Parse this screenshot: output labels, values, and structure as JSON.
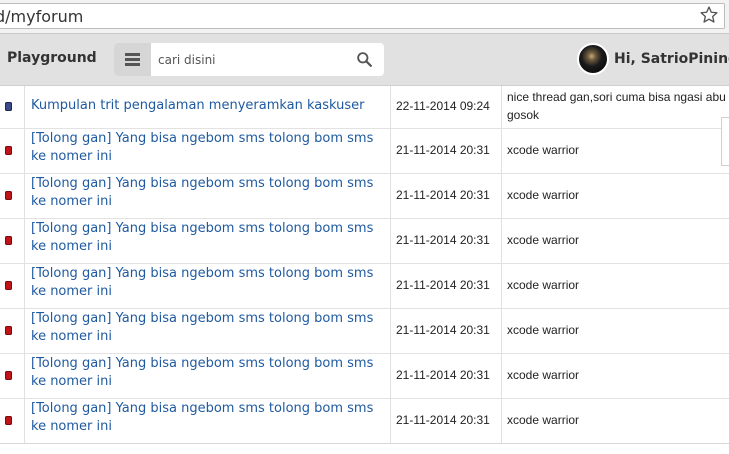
{
  "browser": {
    "url": "d/myforum"
  },
  "header": {
    "brand": "Playground",
    "search_placeholder": "cari disini",
    "greeting": "Hi, SatrioPininggi"
  },
  "threads": [
    {
      "title": "Kumpulan trit pengalaman menyeramkan kaskuser",
      "date": "22-11-2014 09:24",
      "last": "nice thread gan,sori cuma bisa ngasi abu gosok",
      "status": "blue"
    },
    {
      "title": "[Tolong gan] Yang bisa ngebom sms tolong bom sms ke nomer ini",
      "date": "21-11-2014 20:31",
      "last": "xcode warrior",
      "status": "red"
    },
    {
      "title": "[Tolong gan] Yang bisa ngebom sms tolong bom sms ke nomer ini",
      "date": "21-11-2014 20:31",
      "last": "xcode warrior",
      "status": "red"
    },
    {
      "title": "[Tolong gan] Yang bisa ngebom sms tolong bom sms ke nomer ini",
      "date": "21-11-2014 20:31",
      "last": "xcode warrior",
      "status": "red"
    },
    {
      "title": "[Tolong gan] Yang bisa ngebom sms tolong bom sms ke nomer ini",
      "date": "21-11-2014 20:31",
      "last": "xcode warrior",
      "status": "red"
    },
    {
      "title": "[Tolong gan] Yang bisa ngebom sms tolong bom sms ke nomer ini",
      "date": "21-11-2014 20:31",
      "last": "xcode warrior",
      "status": "red"
    },
    {
      "title": "[Tolong gan] Yang bisa ngebom sms tolong bom sms ke nomer ini",
      "date": "21-11-2014 20:31",
      "last": "xcode warrior",
      "status": "red"
    },
    {
      "title": "[Tolong gan] Yang bisa ngebom sms tolong bom sms ke nomer ini",
      "date": "21-11-2014 20:31",
      "last": "xcode warrior",
      "status": "red"
    }
  ]
}
